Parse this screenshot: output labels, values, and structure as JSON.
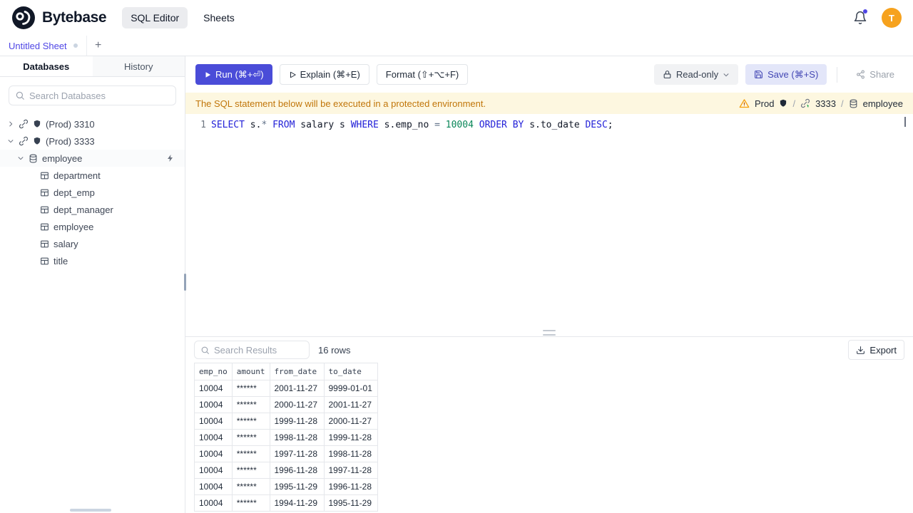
{
  "colors": {
    "accent": "#4a4cd8",
    "banner_bg": "#fdf7e0",
    "banner_text": "#c1760a",
    "keyword": "#2321d8",
    "number": "#098658",
    "avatar_bg": "#f6a21e",
    "warning": "#f59e0b"
  },
  "header": {
    "brand": "Bytebase",
    "nav": [
      {
        "label": "SQL Editor",
        "active": true
      },
      {
        "label": "Sheets",
        "active": false
      }
    ],
    "avatar_letter": "T"
  },
  "tabbar": {
    "tabs": [
      {
        "label": "Untitled Sheet",
        "dirty": true
      }
    ],
    "add_label": "+"
  },
  "sidebar": {
    "tabs": [
      {
        "label": "Databases",
        "active": true
      },
      {
        "label": "History",
        "active": false
      }
    ],
    "search_placeholder": "Search Databases",
    "tree": [
      {
        "kind": "instance",
        "label": "(Prod) 3310",
        "expanded": false
      },
      {
        "kind": "instance",
        "label": "(Prod) 3333",
        "expanded": true
      },
      {
        "kind": "database",
        "label": "employee",
        "expanded": true,
        "selected": true
      },
      {
        "kind": "table",
        "label": "department"
      },
      {
        "kind": "table",
        "label": "dept_emp"
      },
      {
        "kind": "table",
        "label": "dept_manager"
      },
      {
        "kind": "table",
        "label": "employee"
      },
      {
        "kind": "table",
        "label": "salary"
      },
      {
        "kind": "table",
        "label": "title"
      }
    ]
  },
  "toolbar": {
    "run_label": "Run (⌘+⏎)",
    "explain_label": "Explain (⌘+E)",
    "format_label": "Format (⇧+⌥+F)",
    "readonly_label": "Read-only",
    "save_label": "Save (⌘+S)",
    "share_label": "Share"
  },
  "banner": {
    "message": "The SQL statement below will be executed in a protected environment.",
    "env": "Prod",
    "separator": "/",
    "instance": "3333",
    "database": "employee"
  },
  "editor": {
    "line_number": "1",
    "sql_text": "SELECT s.* FROM salary s WHERE s.emp_no = 10004 ORDER BY s.to_date DESC;",
    "tokens": [
      {
        "t": "SELECT",
        "c": "kw"
      },
      {
        "t": " s.",
        "c": "plain"
      },
      {
        "t": "*",
        "c": "op"
      },
      {
        "t": " ",
        "c": "plain"
      },
      {
        "t": "FROM",
        "c": "kw"
      },
      {
        "t": " salary s ",
        "c": "plain"
      },
      {
        "t": "WHERE",
        "c": "kw"
      },
      {
        "t": " s.emp_no ",
        "c": "plain"
      },
      {
        "t": "=",
        "c": "op"
      },
      {
        "t": " ",
        "c": "plain"
      },
      {
        "t": "10004",
        "c": "num"
      },
      {
        "t": " ",
        "c": "plain"
      },
      {
        "t": "ORDER",
        "c": "kw"
      },
      {
        "t": " ",
        "c": "plain"
      },
      {
        "t": "BY",
        "c": "kw"
      },
      {
        "t": " s.to_date ",
        "c": "plain"
      },
      {
        "t": "DESC",
        "c": "kw"
      },
      {
        "t": ";",
        "c": "plain"
      }
    ]
  },
  "results": {
    "search_placeholder": "Search Results",
    "row_count": "16 rows",
    "export_label": "Export",
    "columns": [
      "emp_no",
      "amount",
      "from_date",
      "to_date"
    ],
    "rows": [
      [
        "10004",
        "******",
        "2001-11-27",
        "9999-01-01"
      ],
      [
        "10004",
        "******",
        "2000-11-27",
        "2001-11-27"
      ],
      [
        "10004",
        "******",
        "1999-11-28",
        "2000-11-27"
      ],
      [
        "10004",
        "******",
        "1998-11-28",
        "1999-11-28"
      ],
      [
        "10004",
        "******",
        "1997-11-28",
        "1998-11-28"
      ],
      [
        "10004",
        "******",
        "1996-11-28",
        "1997-11-28"
      ],
      [
        "10004",
        "******",
        "1995-11-29",
        "1996-11-28"
      ],
      [
        "10004",
        "******",
        "1994-11-29",
        "1995-11-29"
      ]
    ]
  }
}
